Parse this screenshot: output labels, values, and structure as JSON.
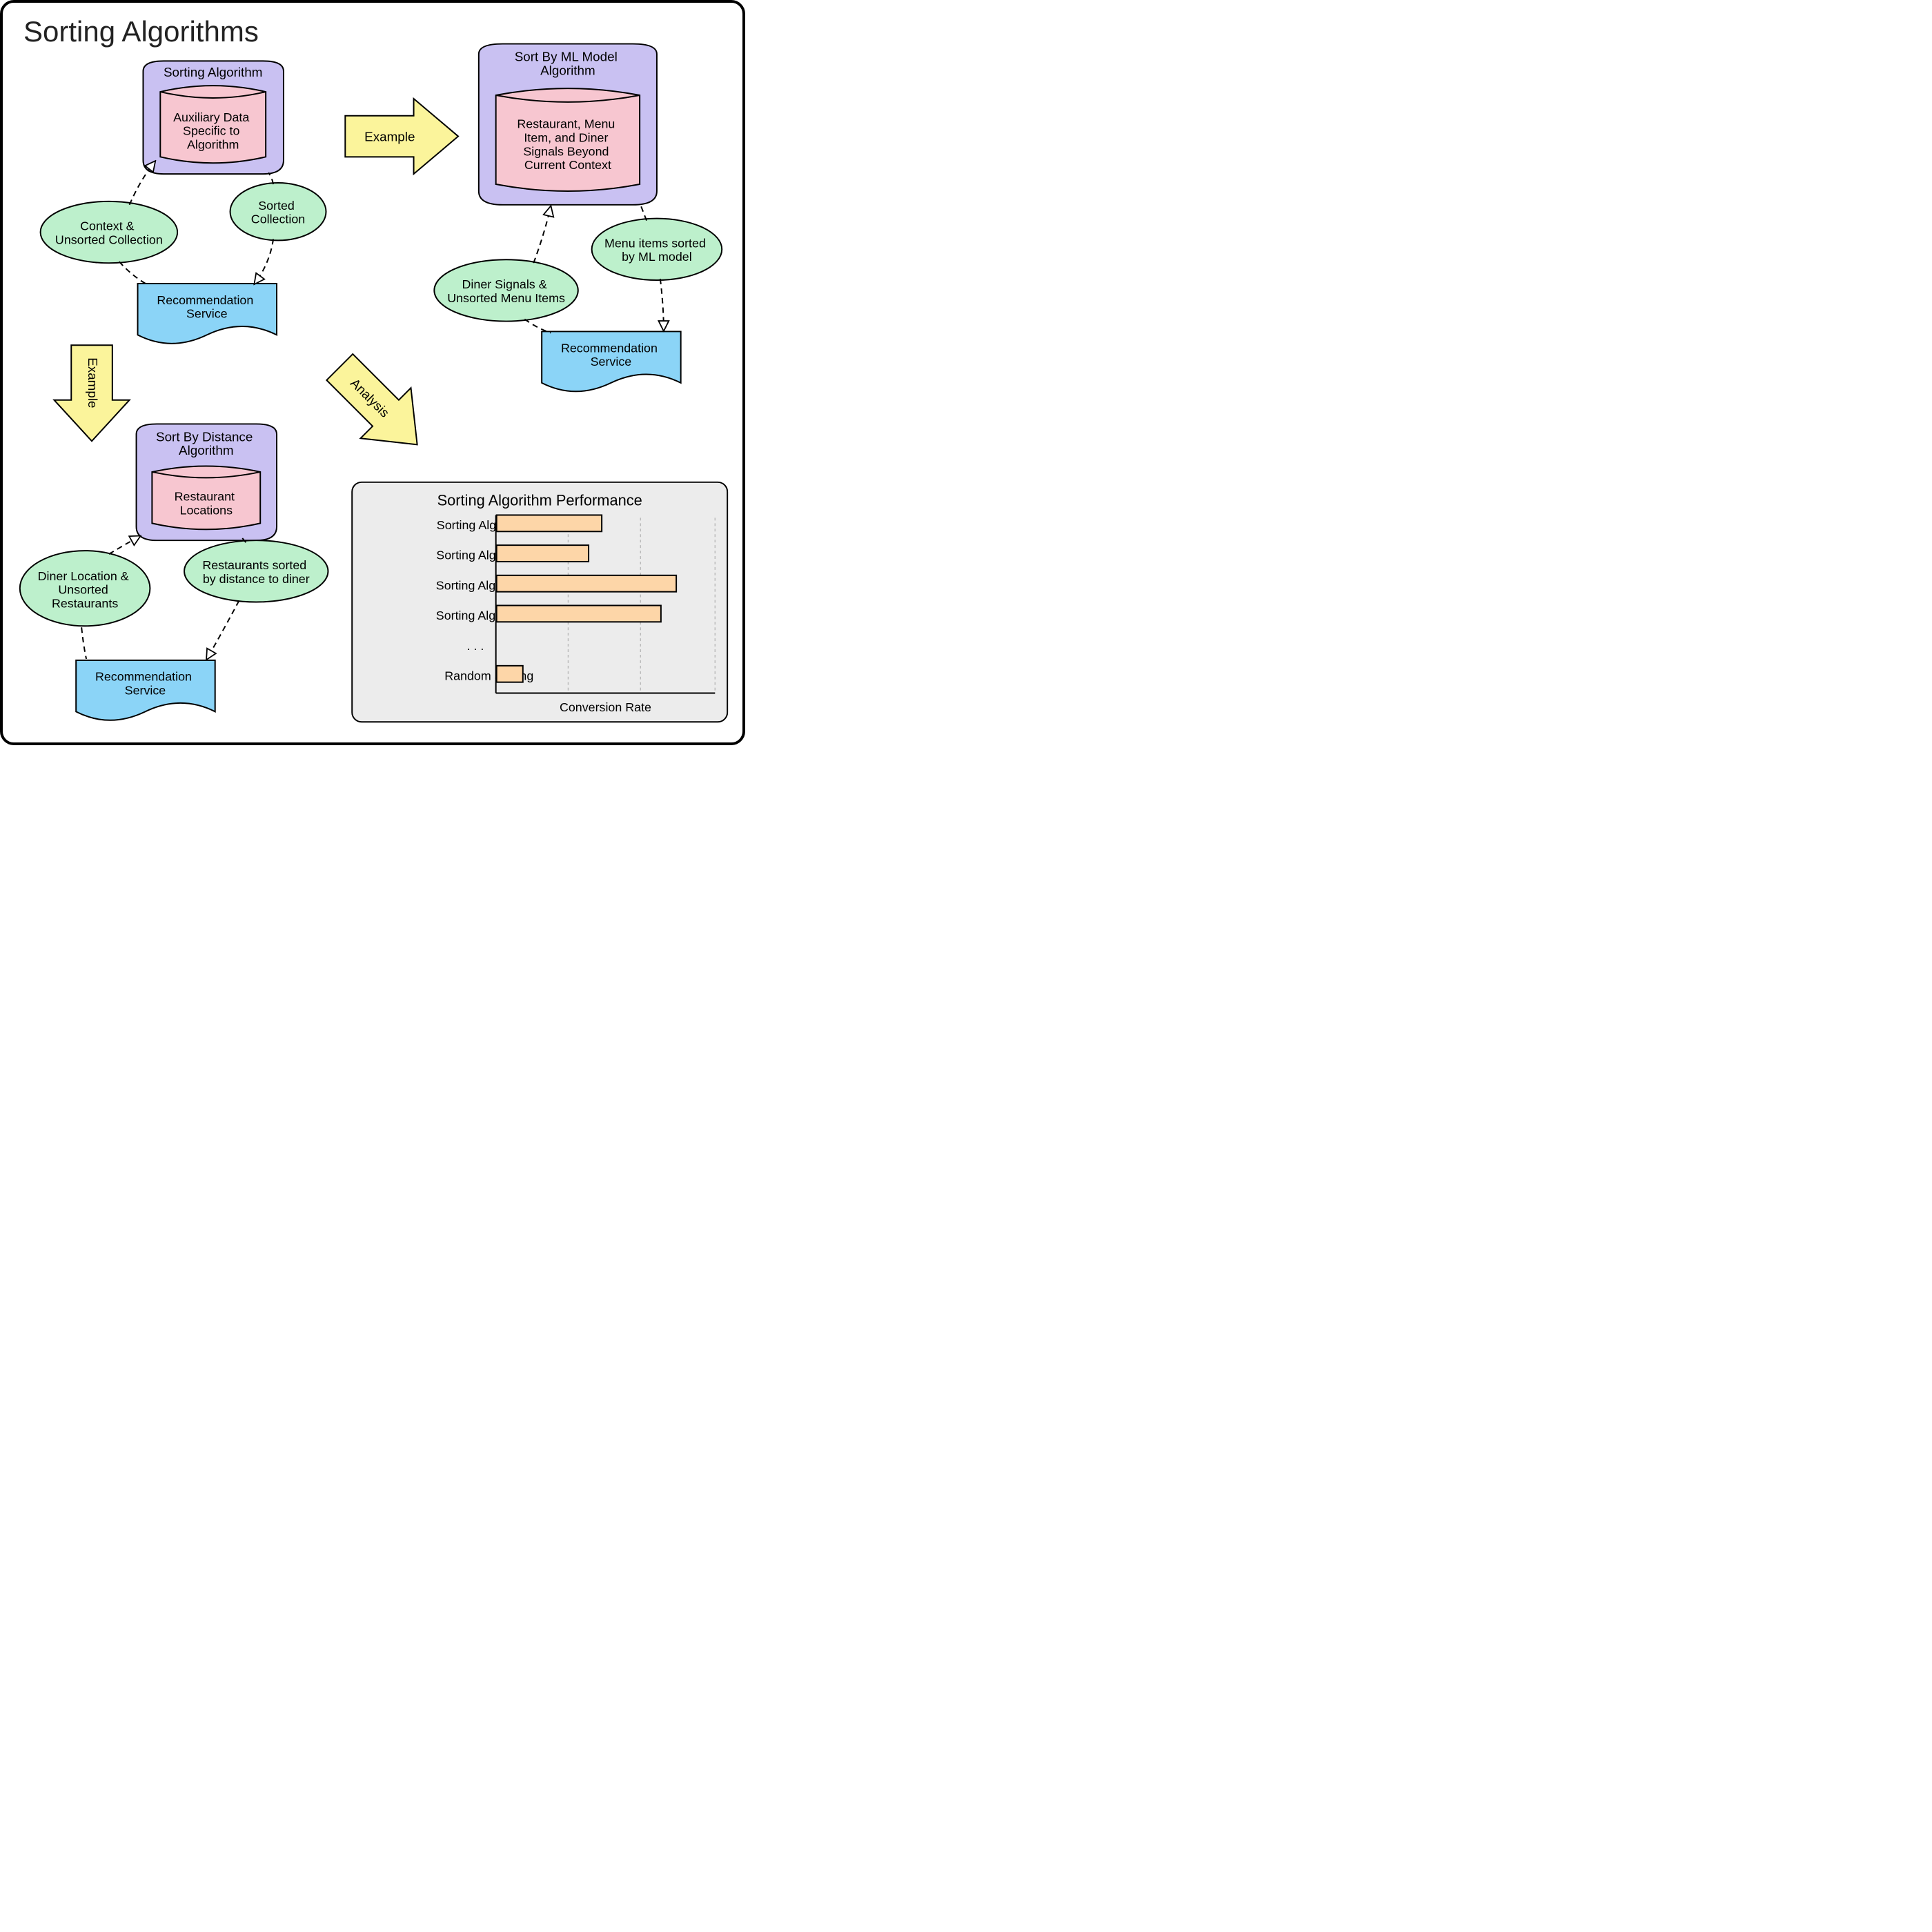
{
  "title": "Sorting Algorithms",
  "groups": {
    "generic": {
      "container": "Sorting Algorithm",
      "db": "Auxiliary Data\nSpecific to\nAlgorithm",
      "input": "Context &\nUnsorted Collection",
      "output": "Sorted\nCollection",
      "service": "Recommendation\nService"
    },
    "ml": {
      "container": "Sort By ML Model\nAlgorithm",
      "db": "Restaurant, Menu\nItem, and Diner\nSignals Beyond\nCurrent Context",
      "input": "Diner Signals &\nUnsorted Menu Items",
      "output": "Menu items sorted\nby ML model",
      "service": "Recommendation\nService"
    },
    "distance": {
      "container": "Sort By Distance\nAlgorithm",
      "db": "Restaurant\nLocations",
      "input": "Diner Location &\nUnsorted\nRestaurants",
      "output": "Restaurants sorted\nby distance to diner",
      "service": "Recommendation\nService"
    }
  },
  "arrows": {
    "example1": "Example",
    "example2": "Example",
    "analysis": "Analysis"
  },
  "chart": {
    "title": "Sorting Algorithm Performance",
    "xlabel": "Conversion Rate",
    "ellipsis": ". . ."
  },
  "chart_data": {
    "type": "bar",
    "orientation": "horizontal",
    "title": "Sorting Algorithm Performance",
    "xlabel": "Conversion Rate",
    "ylabel": "",
    "categories": [
      "Sorting Algorithm A",
      "Sorting Algorithm B",
      "Sorting Algorithm C",
      "Sorting Algorithm D",
      "Random Sorting"
    ],
    "values": [
      48,
      42,
      82,
      75,
      12
    ],
    "xlim": [
      0,
      100
    ],
    "gridlines_x": [
      33,
      66,
      100
    ],
    "note": "Ellipsis row shown between 'Sorting Algorithm D' and 'Random Sorting' indicating omitted rows."
  },
  "colors": {
    "container_fill": "#c9c1f2",
    "db_fill": "#f7c6d0",
    "ellipse_fill": "#bdf0cc",
    "service_fill": "#8bd4f7",
    "arrow_fill": "#fbf49b",
    "chart_bar": "#fdd6a8",
    "chart_bg": "#ececec"
  }
}
